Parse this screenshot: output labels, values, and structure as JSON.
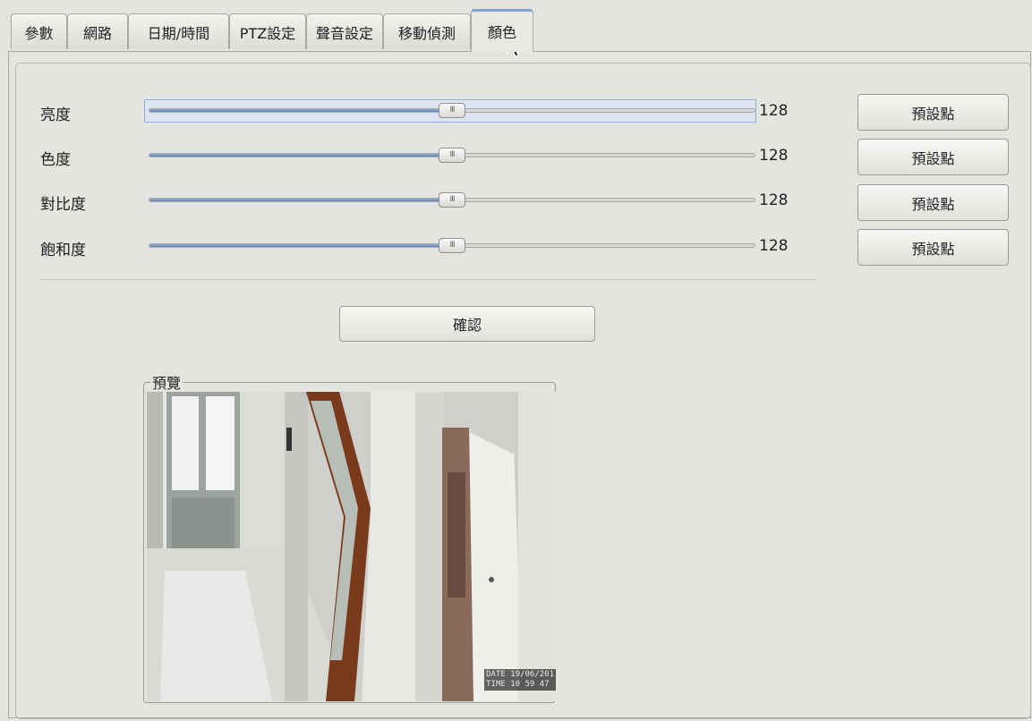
{
  "tabs": [
    {
      "label": "參數"
    },
    {
      "label": "網路"
    },
    {
      "label": "日期/時間"
    },
    {
      "label": "PTZ設定"
    },
    {
      "label": "聲音設定"
    },
    {
      "label": "移動偵測"
    },
    {
      "label": "顏色",
      "active": true
    }
  ],
  "sliders": [
    {
      "label": "亮度",
      "value": "128",
      "fraction": 0.5,
      "reset_label": "預設點",
      "focused": true
    },
    {
      "label": "色度",
      "value": "128",
      "fraction": 0.5,
      "reset_label": "預設點"
    },
    {
      "label": "對比度",
      "value": "128",
      "fraction": 0.5,
      "reset_label": "預設點"
    },
    {
      "label": "飽和度",
      "value": "128",
      "fraction": 0.5,
      "reset_label": "預設點"
    }
  ],
  "thumb_grip": "III",
  "confirm_label": "確認",
  "preview": {
    "title": "預覽",
    "osd_date": "DATE 19/06/201",
    "osd_time": "TIME 10 59 47"
  },
  "colors": {
    "active_tab_accent": "#7fa5d0",
    "slider_fill": "#5d86bb"
  }
}
